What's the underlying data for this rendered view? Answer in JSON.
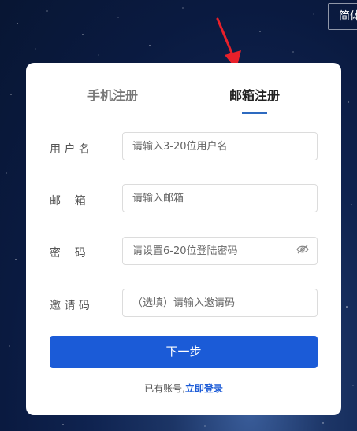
{
  "header": {
    "language_label": "简体中文"
  },
  "tabs": [
    {
      "label": "手机注册",
      "active": false
    },
    {
      "label": "邮箱注册",
      "active": true
    }
  ],
  "form": {
    "username": {
      "label": "用 户 名",
      "placeholder": "请输入3-20位用户名"
    },
    "email": {
      "label": "邮    箱",
      "placeholder": "请输入邮箱"
    },
    "password": {
      "label": "密    码",
      "placeholder": "请设置6-20位登陆密码",
      "toggle_icon": "eye-slash-icon"
    },
    "invite": {
      "label": "邀 请 码",
      "placeholder": "（选填）请输入邀请码"
    }
  },
  "next_button": {
    "label": "下一步"
  },
  "footer": {
    "prompt": "已有账号,",
    "login_link": "立即登录"
  },
  "colors": {
    "primary": "#1b5bd7",
    "tab_underline": "#2d6ac0",
    "annotation_arrow": "#e8202a"
  },
  "annotation": {
    "icon": "red-arrow-icon"
  }
}
